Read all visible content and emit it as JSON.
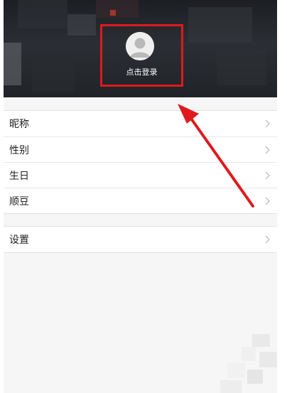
{
  "header": {
    "login_label": "点击登录",
    "avatar_icon": "user-avatar-icon"
  },
  "profile_items": [
    {
      "label": "昵称",
      "icon": "chevron-right-icon"
    },
    {
      "label": "性别",
      "icon": "chevron-right-icon"
    },
    {
      "label": "生日",
      "icon": "chevron-right-icon"
    },
    {
      "label": "顺豆",
      "icon": "chevron-right-icon"
    }
  ],
  "settings_items": [
    {
      "label": "设置",
      "icon": "chevron-right-icon"
    }
  ],
  "colors": {
    "annotation": "#e0191e",
    "header_bg": "#24272b",
    "chevron": "#b5b5b5"
  }
}
